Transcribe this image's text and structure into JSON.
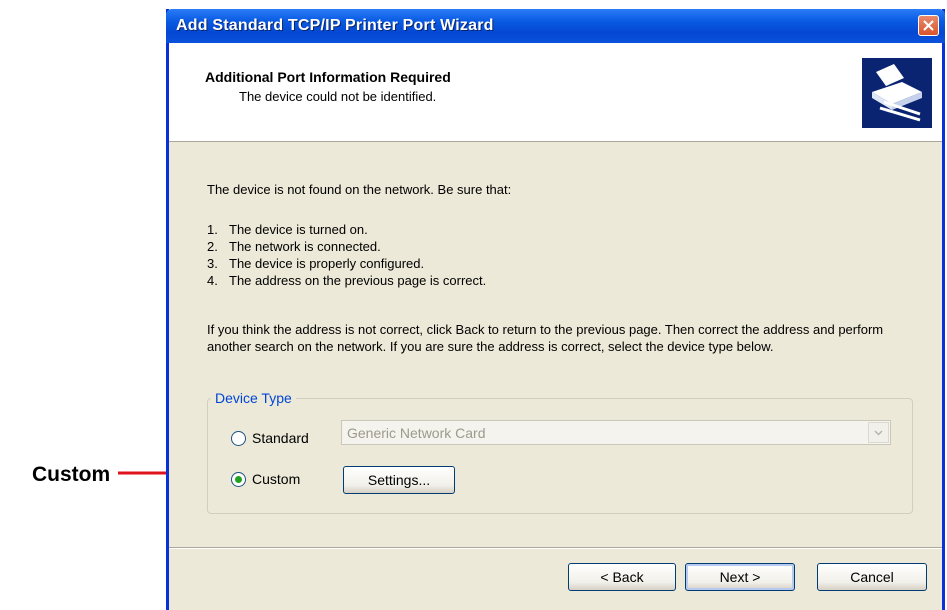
{
  "callout": {
    "label": "Custom"
  },
  "window": {
    "title": "Add Standard TCP/IP Printer Port Wizard"
  },
  "header": {
    "title": "Additional Port Information Required",
    "subtitle": "The device could not be identified."
  },
  "body": {
    "intro": "The device is not found on the network.  Be sure that:",
    "list": [
      {
        "num": "1.",
        "text": "The device is turned on."
      },
      {
        "num": "2.",
        "text": "The network is connected."
      },
      {
        "num": "3.",
        "text": "The device is properly configured."
      },
      {
        "num": "4.",
        "text": "The address on the previous page is correct."
      }
    ],
    "paragraph": "If you think the address is not correct, click Back to return to the previous page.  Then correct the address and perform another search on the network.  If you are sure the address is correct, select the device type below."
  },
  "device_type": {
    "legend": "Device Type",
    "standard_label": "Standard",
    "standard_selected": false,
    "standard_select_value": "Generic Network Card",
    "custom_label": "Custom",
    "custom_selected": true,
    "settings_button": "Settings..."
  },
  "footer": {
    "back_button": "< Back",
    "next_button": "Next >",
    "cancel_button": "Cancel"
  },
  "colors": {
    "titlebar": "#0a5be2",
    "accent_legend": "#0046d5",
    "callout_arrow": "#e0121b",
    "header_icon_bg": "#0a2472"
  }
}
